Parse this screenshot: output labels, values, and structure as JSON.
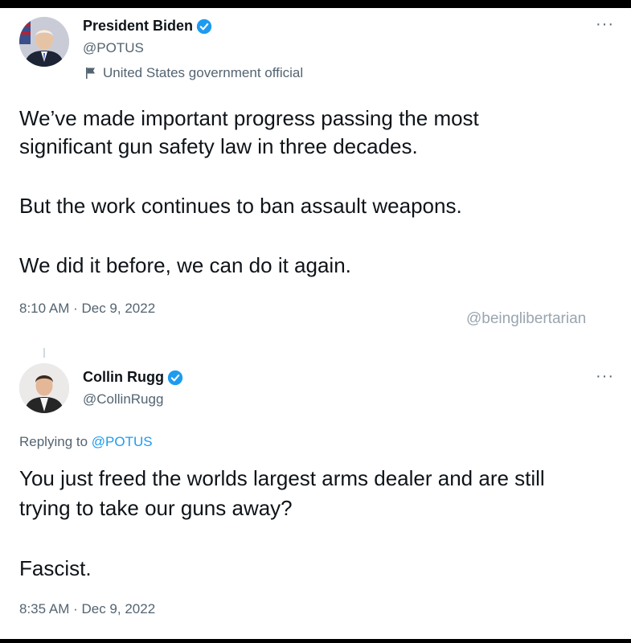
{
  "tweet1": {
    "name": "President Biden",
    "handle": "@POTUS",
    "label": "United States government official",
    "lines": [
      "We’ve made important progress passing the most",
      "significant gun safety law in three decades.",
      "But the work continues to ban assault weapons.",
      "We did it before, we can do it again."
    ],
    "timestamp": "8:10 AM · Dec 9, 2022",
    "more_icon": "more-horizontal-icon"
  },
  "watermark": "@beinglibertarian",
  "tweet2": {
    "name": "Collin Rugg",
    "handle": "@CollinRugg",
    "replying_prefix": "Replying to",
    "replying_to": "@POTUS",
    "lines": [
      "You just freed the worlds largest arms dealer and are still",
      "trying to take our guns away?",
      "Fascist."
    ],
    "timestamp": "8:35 AM · Dec 9, 2022",
    "more_icon": "more-horizontal-icon"
  },
  "colors": {
    "verified": "#1d9bf0",
    "link": "#1d9bf0",
    "secondary_text": "#536471",
    "primary_text": "#0f1419"
  }
}
